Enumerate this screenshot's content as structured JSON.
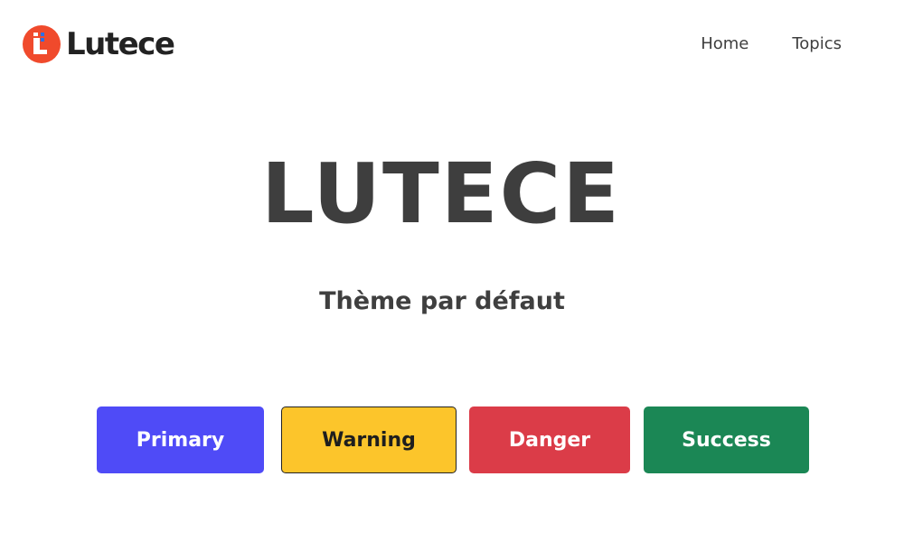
{
  "header": {
    "logo": {
      "text": "Lutece",
      "icon": "lutece-logo-icon",
      "colors": {
        "mark": "#f04a2c",
        "dots": "#2f6fe3",
        "text": "#222222"
      }
    },
    "nav": [
      {
        "label": "Home"
      },
      {
        "label": "Topics"
      }
    ]
  },
  "hero": {
    "title": "LUTECE",
    "subtitle": "Thème par défaut"
  },
  "buttons": [
    {
      "label": "Primary",
      "bg": "#4f4bf7",
      "fg": "#ffffff"
    },
    {
      "label": "Warning",
      "bg": "#fcc52b",
      "fg": "#1e1e1e"
    },
    {
      "label": "Danger",
      "bg": "#db3c48",
      "fg": "#ffffff"
    },
    {
      "label": "Success",
      "bg": "#1b8755",
      "fg": "#ffffff"
    }
  ]
}
